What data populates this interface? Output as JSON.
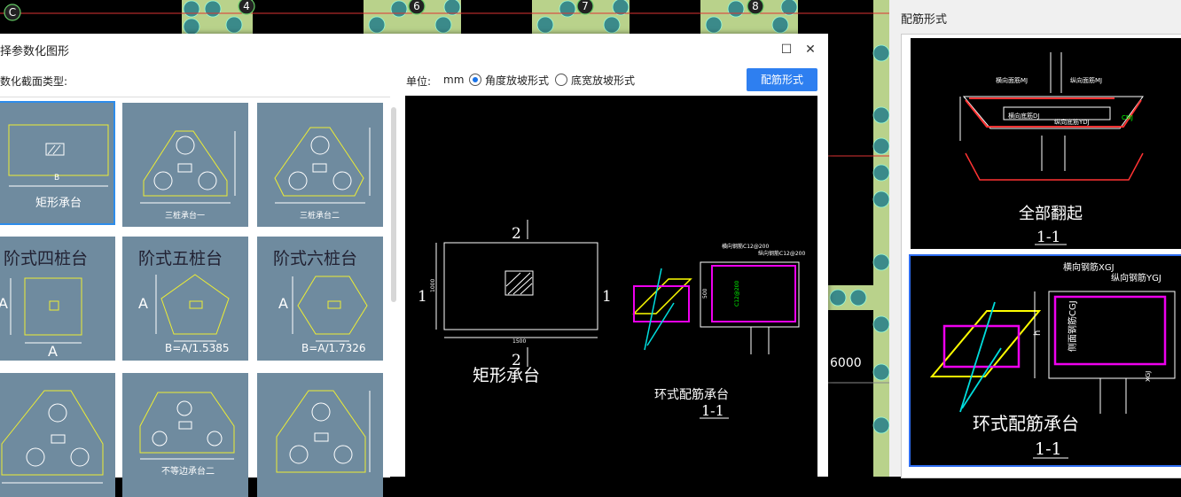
{
  "background": {
    "axis_labels": [
      "C",
      "4",
      "6",
      "7",
      "8"
    ],
    "dim_text": "6000"
  },
  "dialog": {
    "title": "择参数化图形",
    "section_label": "数化截面类型:",
    "unit_label": "单位:",
    "unit_value": "mm",
    "radio_angle": "角度放坡形式",
    "radio_width": "底宽放坡形式",
    "rebar_button": "配筋形式",
    "max_icon": "maximize-icon",
    "close_icon": "close-icon",
    "tiles": [
      {
        "label": "矩形承台",
        "dim": "B"
      },
      {
        "label": "三桩承台一"
      },
      {
        "label": "三桩承台二"
      },
      {
        "label": "阶式四桩台",
        "dim_a": "A",
        "dim_b": "A"
      },
      {
        "label": "阶式五桩台",
        "dim_a": "A",
        "formula": "B=A/1.5385"
      },
      {
        "label": "阶式六桩台",
        "dim_a": "A",
        "formula": "B=A/1.7326"
      },
      {
        "label": ""
      },
      {
        "label": "不等边承台二"
      },
      {
        "label": ""
      }
    ],
    "preview": {
      "section_mark": "2",
      "side_mark": "1",
      "dim_width": "1500",
      "dim_height": "1000",
      "caption": "矩形承台",
      "ring_caption": "环式配筋承台",
      "section_caption": "1-1",
      "rebar_h": "横向钢筋C12@200",
      "rebar_v": "纵向钢筋C12@200",
      "rebar_side": "C12@200",
      "dim_side": "500"
    }
  },
  "panel": {
    "title": "配筋形式",
    "option1": {
      "caption": "全部翻起",
      "section": "1-1",
      "labels": [
        "横向面筋MJ",
        "纵向面筋MJ",
        "横向底筋DJ",
        "纵向底筋YDJ",
        "CMJ"
      ]
    },
    "option2": {
      "caption": "环式配筋承台",
      "section": "1-1",
      "label_h": "横向钢筋XGJ",
      "label_v": "纵向钢筋YGJ",
      "label_side": "侧面钢筋CGJ",
      "label_h1": "h",
      "label_side_w": "XGJ"
    }
  }
}
